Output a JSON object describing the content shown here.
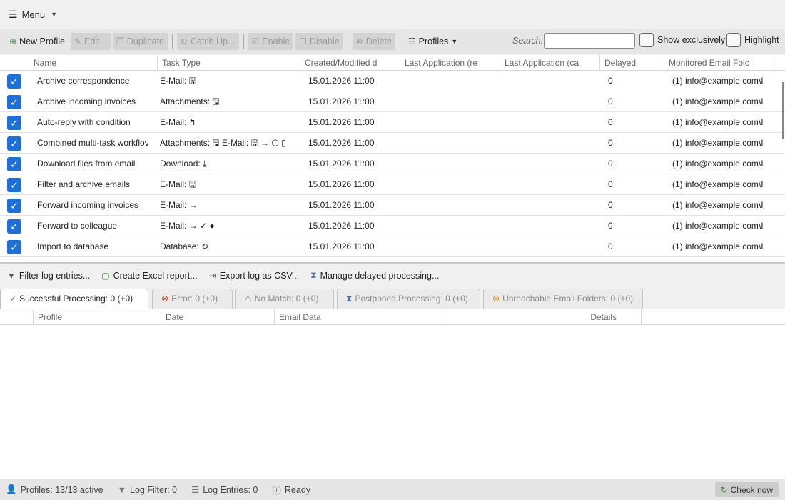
{
  "menubar": {
    "label": "Menu"
  },
  "toolbar": {
    "new_profile": "New Profile",
    "edit": "Edit...",
    "duplicate": "Duplicate",
    "catch_up": "Catch Up...",
    "enable": "Enable",
    "disable": "Disable",
    "delete": "Delete",
    "profiles": "Profiles",
    "search_label": "Search:",
    "search_value": "",
    "show_exclusively": "Show exclusively",
    "highlight": "Highlight"
  },
  "grid": {
    "columns": [
      "Name",
      "Task Type",
      "Created/Modified d",
      "Last Application (re",
      "Last Application (ca",
      "Delayed",
      "Monitored Email Folc"
    ],
    "rows": [
      {
        "name": "Archive correspondence",
        "task_type": "E-Mail: 🖫",
        "created": "15.01.2026 11:00",
        "delayed": "0",
        "folder": "(1) info@example.com\\I"
      },
      {
        "name": "Archive incoming invoices",
        "task_type": "Attachments: 🖫",
        "created": "15.01.2026 11:00",
        "delayed": "0",
        "folder": "(1) info@example.com\\I"
      },
      {
        "name": "Auto-reply with condition",
        "task_type": "E-Mail: ↰",
        "created": "15.01.2026 11:00",
        "delayed": "0",
        "folder": "(1) info@example.com\\I"
      },
      {
        "name": "Combined multi-task workflov",
        "task_type": "Attachments: 🖫  E-Mail: 🖫 → ⬡ ▯",
        "created": "15.01.2026 11:00",
        "delayed": "0",
        "folder": "(1) info@example.com\\I"
      },
      {
        "name": "Download files from email",
        "task_type": "Download: ⤓",
        "created": "15.01.2026 11:00",
        "delayed": "0",
        "folder": "(1) info@example.com\\I"
      },
      {
        "name": "Filter and archive emails",
        "task_type": "E-Mail: 🖫",
        "created": "15.01.2026 11:00",
        "delayed": "0",
        "folder": "(1) info@example.com\\I"
      },
      {
        "name": "Forward incoming invoices",
        "task_type": "E-Mail: →",
        "created": "15.01.2026 11:00",
        "delayed": "0",
        "folder": "(1) info@example.com\\I"
      },
      {
        "name": "Forward to colleague",
        "task_type": "E-Mail: → ✓ ●",
        "created": "15.01.2026 11:00",
        "delayed": "0",
        "folder": "(1) info@example.com\\I"
      },
      {
        "name": "Import to database",
        "task_type": "Database: ↻",
        "created": "15.01.2026 11:00",
        "delayed": "0",
        "folder": "(1) info@example.com\\I"
      }
    ]
  },
  "logbar": {
    "filter": "Filter log entries...",
    "excel": "Create Excel report...",
    "csv": "Export log as CSV...",
    "delayed": "Manage delayed processing..."
  },
  "tabs": [
    {
      "label": "Successful Processing: 0  (+0)"
    },
    {
      "label": "Error: 0  (+0)"
    },
    {
      "label": "No Match: 0  (+0)"
    },
    {
      "label": "Postponed Processing: 0  (+0)"
    },
    {
      "label": "Unreachable Email Folders: 0  (+0)"
    }
  ],
  "loggrid": {
    "columns": [
      "Profile",
      "Date",
      "Email Data",
      "Details"
    ]
  },
  "statusbar": {
    "profiles": "Profiles: 13/13 active",
    "log_filter": "Log Filter: 0",
    "log_entries": "Log Entries: 0",
    "ready": "Ready",
    "check_now": "Check now"
  }
}
